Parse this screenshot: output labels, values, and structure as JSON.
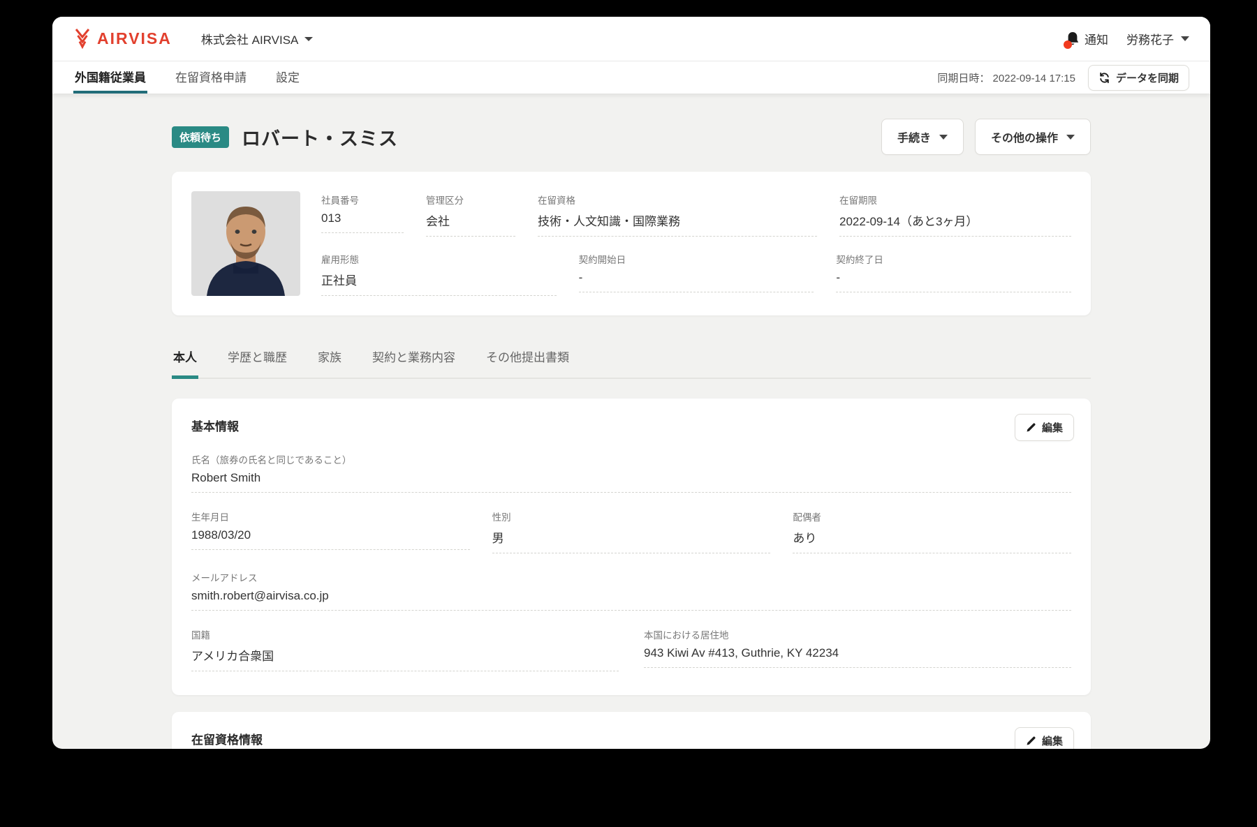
{
  "header": {
    "logo_text": "AIRVISA",
    "company_name": "株式会社 AIRVISA",
    "notification_label": "通知",
    "user_name": "労務花子"
  },
  "nav": {
    "tabs": [
      {
        "label": "外国籍従業員"
      },
      {
        "label": "在留資格申請"
      },
      {
        "label": "設定"
      }
    ],
    "sync_label": "同期日時：",
    "sync_datetime": "2022-09-14 17:15",
    "sync_button_label": "データを同期"
  },
  "page_header": {
    "status_badge": "依頼待ち",
    "title": "ロバート・スミス",
    "procedures_button": "手続き",
    "other_actions_button": "その他の操作"
  },
  "profile_summary": {
    "row1": [
      {
        "label": "社員番号",
        "value": "013"
      },
      {
        "label": "管理区分",
        "value": "会社"
      },
      {
        "label": "在留資格",
        "value": "技術・人文知識・国際業務"
      },
      {
        "label": "在留期限",
        "value": "2022-09-14（あと3ヶ月）"
      }
    ],
    "row2": [
      {
        "label": "雇用形態",
        "value": "正社員"
      },
      {
        "label": "契約開始日",
        "value": "-"
      },
      {
        "label": "契約終了日",
        "value": "-"
      }
    ]
  },
  "content_tabs": [
    {
      "label": "本人"
    },
    {
      "label": "学歴と職歴"
    },
    {
      "label": "家族"
    },
    {
      "label": "契約と業務内容"
    },
    {
      "label": "その他提出書類"
    }
  ],
  "basic_info": {
    "title": "基本情報",
    "edit_button": "編集",
    "name": {
      "label": "氏名（旅券の氏名と同じであること）",
      "value": "Robert Smith"
    },
    "row2": [
      {
        "label": "生年月日",
        "value": "1988/03/20"
      },
      {
        "label": "性別",
        "value": "男"
      },
      {
        "label": "配偶者",
        "value": "あり"
      }
    ],
    "email": {
      "label": "メールアドレス",
      "value": "smith.robert@airvisa.co.jp"
    },
    "row4": [
      {
        "label": "国籍",
        "value": "アメリカ合衆国"
      },
      {
        "label": "本国における居住地",
        "value": "943 Kiwi Av #413, Guthrie, KY 42234"
      }
    ]
  },
  "residence_info": {
    "title": "在留資格情報",
    "edit_button": "編集"
  },
  "colors": {
    "accent_teal": "#2a8a84",
    "brand_red": "#e2402e",
    "notification_dot": "#f13a1e"
  }
}
